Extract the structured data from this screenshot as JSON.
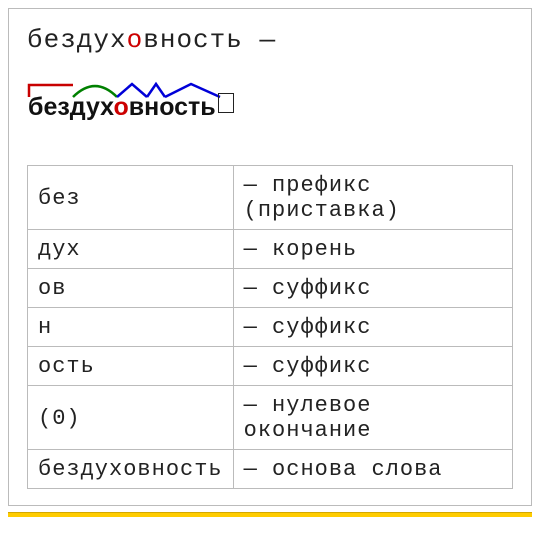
{
  "headline": {
    "before": "бездух",
    "stress": "о",
    "after": "вность —"
  },
  "diagram": {
    "before": "бездух",
    "stress": "о",
    "after": "вность"
  },
  "rows": [
    {
      "part": "без",
      "def": "— префикс (приставка)"
    },
    {
      "part": "дух",
      "def": "— корень"
    },
    {
      "part": "ов",
      "def": "— суффикс"
    },
    {
      "part": "н",
      "def": "— суффикс"
    },
    {
      "part": "ость",
      "def": "— суффикс"
    },
    {
      "part": "(0)",
      "def": "— нулевое окончание"
    },
    {
      "part": "бездуховность",
      "def": "— основа слова"
    }
  ],
  "colors": {
    "prefix": "#c80000",
    "root": "#008000",
    "suffix": "#0000d8"
  }
}
